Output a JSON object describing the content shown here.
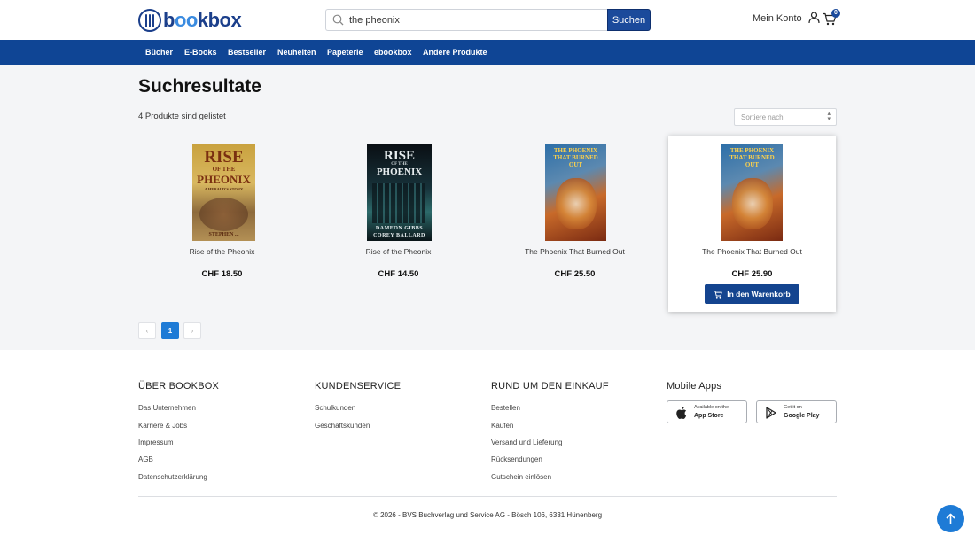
{
  "header": {
    "logo": {
      "part1": "b",
      "part_o": "oo",
      "part2": "kbox"
    },
    "search": {
      "value": "the pheonix",
      "button_label": "Suchen"
    },
    "account_label": "Mein Konto",
    "cart_count": "0"
  },
  "nav": {
    "items": [
      "Bücher",
      "E-Books",
      "Bestseller",
      "Neuheiten",
      "Papeterie",
      "ebookbox",
      "Andere Produkte"
    ]
  },
  "main": {
    "title": "Suchresultate",
    "result_count": "4 Produkte sind gelistet",
    "sort_placeholder": "Sortiere nach",
    "products": [
      {
        "title": "Rise of the Pheonix",
        "price": "CHF 18.50",
        "cover": {
          "line1": "RISE",
          "line2": "OF THE",
          "line3": "PHEONIX",
          "line4": "A HERALD'S STORY",
          "author": "STEPHEN ..."
        }
      },
      {
        "title": "Rise of the Pheonix",
        "price": "CHF 14.50",
        "cover": {
          "line1": "RISE",
          "line2": "OF THE",
          "line3": "PHOENIX",
          "author1": "DAMEON GIBBS",
          "author2": "COREY BALLARD"
        }
      },
      {
        "title": "The Phoenix That Burned Out",
        "price": "CHF 25.50",
        "cover": {
          "line1": "THE PHOENIX",
          "line2": "THAT BURNED",
          "line3": "OUT"
        }
      },
      {
        "title": "The Phoenix That Burned Out",
        "price": "CHF 25.90",
        "cover": {
          "line1": "THE PHOENIX",
          "line2": "THAT BURNED",
          "line3": "OUT"
        },
        "button_label": "In den Warenkorb"
      }
    ],
    "pagination": {
      "prev": "‹",
      "current": "1",
      "next": "›"
    }
  },
  "footer": {
    "columns": [
      {
        "heading": "ÜBER BOOKBOX",
        "links": [
          "Das Unternehmen",
          "Karriere & Jobs",
          "Impressum",
          "AGB",
          "Datenschutzerklärung"
        ]
      },
      {
        "heading": "KUNDENSERVICE",
        "links": [
          "Schulkunden",
          "Geschäftskunden"
        ]
      },
      {
        "heading": "RUND UM DEN EINKAUF",
        "links": [
          "Bestellen",
          "Kaufen",
          "Versand und Lieferung",
          "Rücksendungen",
          "Gutschein einlösen"
        ]
      },
      {
        "heading": "Mobile Apps",
        "links": []
      }
    ],
    "apps": [
      {
        "line1": "Available on the",
        "line2": "App Store"
      },
      {
        "line1": "Get it on",
        "line2": "Google Play"
      }
    ],
    "copyright": "© 2026 - BVS Buchverlag und Service AG - Bösch 106, 6331 Hünenberg"
  },
  "colors": {
    "brand": "#0f4595",
    "accent": "#1e7bd6",
    "button": "#14448f"
  }
}
